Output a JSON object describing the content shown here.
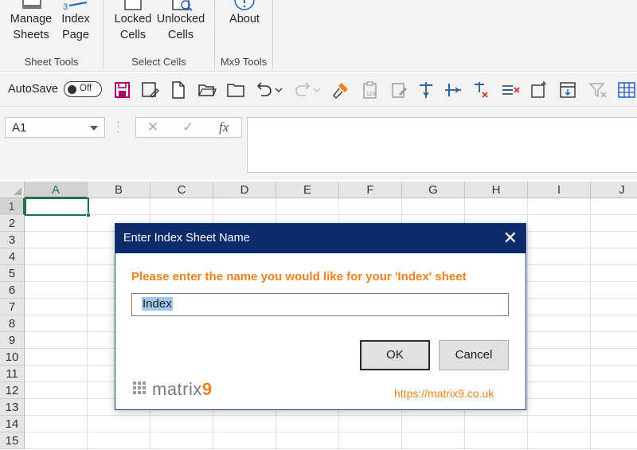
{
  "ribbon": {
    "buttons": [
      {
        "line1": "Manage",
        "line2": "Sheets"
      },
      {
        "line1": "Index",
        "line2": "Page"
      },
      {
        "line1": "Locked",
        "line2": "Cells"
      },
      {
        "line1": "Unlocked",
        "line2": "Cells"
      },
      {
        "line1": "About",
        "line2": ""
      }
    ],
    "groups": [
      "Sheet Tools",
      "Select Cells",
      "Mx9 Tools"
    ]
  },
  "qat": {
    "autosave_label": "AutoSave",
    "autosave_state": "Off"
  },
  "formula_bar": {
    "name_box": "A1",
    "cancel_symbol": "✕",
    "enter_symbol": "✓",
    "fx_symbol": "fx",
    "formula": ""
  },
  "grid": {
    "columns": [
      "A",
      "B",
      "C",
      "D",
      "E",
      "F",
      "G",
      "H",
      "I",
      "J"
    ],
    "rows": [
      "1",
      "2",
      "3",
      "4",
      "5",
      "6",
      "7",
      "8",
      "9",
      "10",
      "11",
      "12",
      "13",
      "14",
      "15"
    ],
    "active_cell": "A1"
  },
  "dialog": {
    "title": "Enter Index Sheet Name",
    "prompt": "Please enter the name you would like for your 'Index' sheet",
    "input_value": "Index",
    "ok_label": "OK",
    "cancel_label": "Cancel",
    "logo_text": "matrix",
    "logo_digit": "9",
    "link": "https://matrix9.co.uk"
  },
  "colors": {
    "dialog_title_bg": "#0c2b6b",
    "accent_orange": "#f0821e",
    "excel_green": "#217346",
    "save_icon": "#a8006e"
  }
}
